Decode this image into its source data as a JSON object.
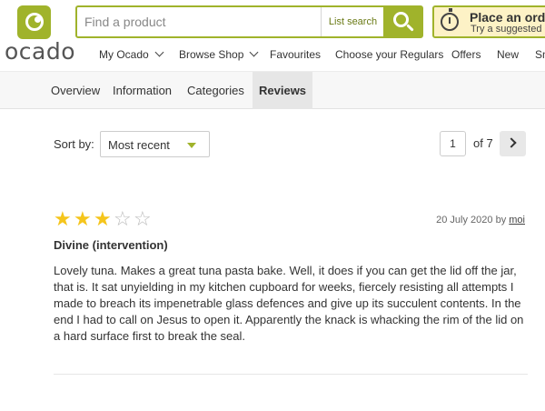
{
  "brand": {
    "logo_text": "ocado",
    "accent_color": "#a0b32b"
  },
  "search": {
    "placeholder": "Find a product",
    "list_search_label": "List search"
  },
  "order": {
    "title": "Place an order",
    "subtitle": "Try a suggested order"
  },
  "nav": {
    "items": [
      {
        "label": "My Ocado",
        "has_dropdown": true
      },
      {
        "label": "Browse Shop",
        "has_dropdown": true
      },
      {
        "label": "Favourites",
        "has_dropdown": false
      },
      {
        "label": "Choose your Regulars",
        "has_dropdown": false
      },
      {
        "label": "Offers",
        "has_dropdown": false
      },
      {
        "label": "New",
        "has_dropdown": false
      },
      {
        "label": "Sm",
        "has_dropdown": false
      }
    ]
  },
  "tabs": [
    {
      "label": "Overview",
      "active": false
    },
    {
      "label": "Information",
      "active": false
    },
    {
      "label": "Categories",
      "active": false
    },
    {
      "label": "Reviews",
      "active": true
    }
  ],
  "sort": {
    "label": "Sort by:",
    "selected": "Most recent"
  },
  "pagination": {
    "current_page": "1",
    "of_label": "of 7"
  },
  "review": {
    "rating": 3,
    "max_rating": 5,
    "date": "20 July 2020",
    "by_label": "by",
    "author": "moi",
    "title": "Divine (intervention)",
    "body": "Lovely tuna. Makes a great tuna pasta bake. Well, it does if you can get the lid off the jar, that is. It sat unyielding in my kitchen cupboard for weeks, fiercely resisting all attempts I made to breach its impenetrable glass defences and give up its succulent contents. In the end I had to call on Jesus to open it. Apparently the knack is whacking the rim of the lid on a hard surface first to break the seal."
  }
}
